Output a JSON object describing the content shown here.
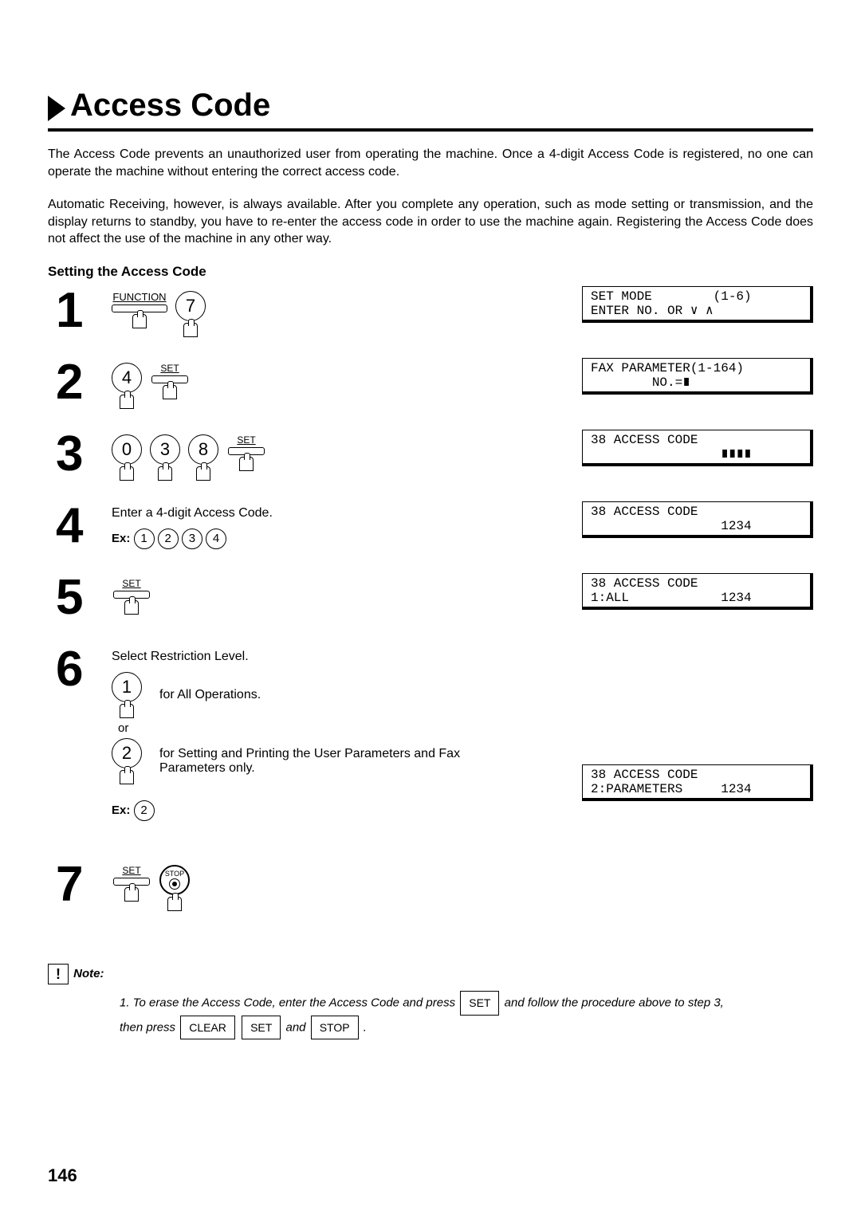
{
  "title": "Access Code",
  "intro1": "The Access Code prevents an unauthorized user from operating the machine.  Once a 4-digit Access Code is registered, no one can operate the machine without entering the correct access code.",
  "intro2": "Automatic Receiving, however, is always available.  After you complete any operation, such as mode setting or transmission, and the display returns to standby, you have to re-enter the access code in order to use the machine again.  Registering the Access Code does not affect the use of the machine in any other way.",
  "subheading": "Setting the Access Code",
  "steps": {
    "s1": {
      "num": "1",
      "func": "FUNCTION",
      "key": "7",
      "lcd": "SET MODE        (1-6)\nENTER NO. OR ∨ ∧"
    },
    "s2": {
      "num": "2",
      "key": "4",
      "set": "SET",
      "lcd": "FAX PARAMETER(1-164)\n        NO.=∎"
    },
    "s3": {
      "num": "3",
      "k1": "0",
      "k2": "3",
      "k3": "8",
      "set": "SET",
      "lcd": "38 ACCESS CODE\n                 ∎∎∎∎"
    },
    "s4": {
      "num": "4",
      "text": "Enter a 4-digit Access Code.",
      "ex_label": "Ex:",
      "e1": "1",
      "e2": "2",
      "e3": "3",
      "e4": "4",
      "lcd": "38 ACCESS CODE\n                 1234"
    },
    "s5": {
      "num": "5",
      "set": "SET",
      "lcd": "38 ACCESS CODE\n1:ALL            1234"
    },
    "s6": {
      "num": "6",
      "text": "Select Restriction Level.",
      "opt1": "1",
      "opt1_desc": "for All Operations.",
      "or": "or",
      "opt2": "2",
      "opt2_desc": "for Setting and Printing the User Parameters and Fax Parameters only.",
      "lcd": "38 ACCESS CODE\n2:PARAMETERS     1234",
      "ex_label": "Ex:",
      "ex_key": "2"
    },
    "s7": {
      "num": "7",
      "set": "SET",
      "stop": "STOP"
    }
  },
  "note": {
    "label": "Note:",
    "line1_a": "1. To erase the Access Code, enter the Access Code and press ",
    "btn_set": "SET",
    "line1_b": " and follow the procedure above to step 3,",
    "line2_a": "then press ",
    "btn_clear": "CLEAR",
    "line2_b": " ",
    "line2_c": " and ",
    "btn_stop": "STOP",
    "line2_d": " ."
  },
  "page": "146"
}
